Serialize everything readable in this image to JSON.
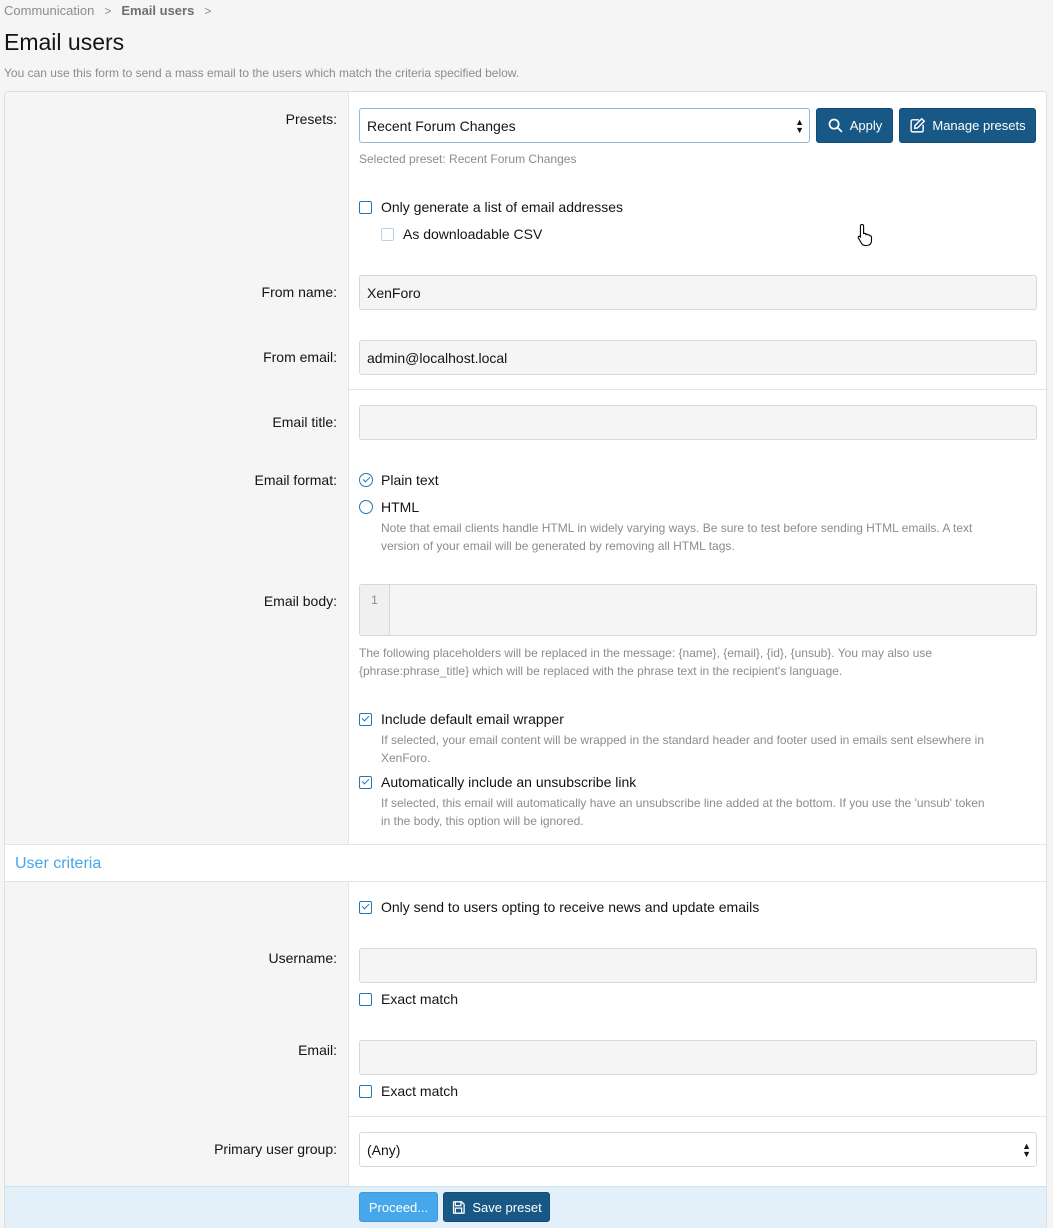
{
  "breadcrumb": {
    "items": [
      "Communication",
      "Email users"
    ],
    "separator": ">"
  },
  "page": {
    "title": "Email users",
    "description": "You can use this form to send a mass email to the users which match the criteria specified below."
  },
  "presets": {
    "label": "Presets:",
    "selected": "Recent Forum Changes",
    "apply_label": "Apply",
    "manage_label": "Manage presets",
    "hint": "Selected preset: Recent Forum Changes"
  },
  "options": {
    "list_only_label": "Only generate a list of email addresses",
    "list_only_checked": false,
    "csv_label": "As downloadable CSV",
    "csv_checked": false
  },
  "from_name": {
    "label": "From name:",
    "value": "XenForo"
  },
  "from_email": {
    "label": "From email:",
    "value": "admin@localhost.local"
  },
  "email_title": {
    "label": "Email title:",
    "value": ""
  },
  "email_format": {
    "label": "Email format:",
    "plain_label": "Plain text",
    "plain_selected": true,
    "html_label": "HTML",
    "html_selected": false,
    "html_note_1": "Note that email clients handle HTML in widely varying ways. Be sure to test before sending HTML emails. A text",
    "html_note_2": "version of your email will be generated by removing all HTML tags."
  },
  "email_body": {
    "label": "Email body:",
    "line_number": "1",
    "hint_1": "The following placeholders will be replaced in the message: {name}, {email}, {id}, {unsub}. You may also use",
    "hint_2": "{phrase:phrase_title} which will be replaced with the phrase text in the recipient's language."
  },
  "wrapper": {
    "label": "Include default email wrapper",
    "checked": true,
    "hint_1": "If selected, your email content will be wrapped in the standard header and footer used in emails sent elsewhere in",
    "hint_2": "XenForo."
  },
  "unsubscribe": {
    "label": "Automatically include an unsubscribe link",
    "checked": true,
    "hint_1": "If selected, this email will automatically have an unsubscribe line added at the bottom. If you use the 'unsub' token",
    "hint_2": "in the body, this option will be ignored."
  },
  "user_criteria": {
    "heading": "User criteria",
    "opt_in_label": "Only send to users opting to receive news and update emails",
    "opt_in_checked": true,
    "username_label": "Username:",
    "username_value": "",
    "username_exact_label": "Exact match",
    "email_label": "Email:",
    "email_value": "",
    "email_exact_label": "Exact match",
    "group_label": "Primary user group:",
    "group_value": "(Any)"
  },
  "footer": {
    "proceed_label": "Proceed...",
    "save_label": "Save preset"
  },
  "colors": {
    "primary": "#185886",
    "accent": "#47a7eb",
    "check": "#2577b1"
  }
}
